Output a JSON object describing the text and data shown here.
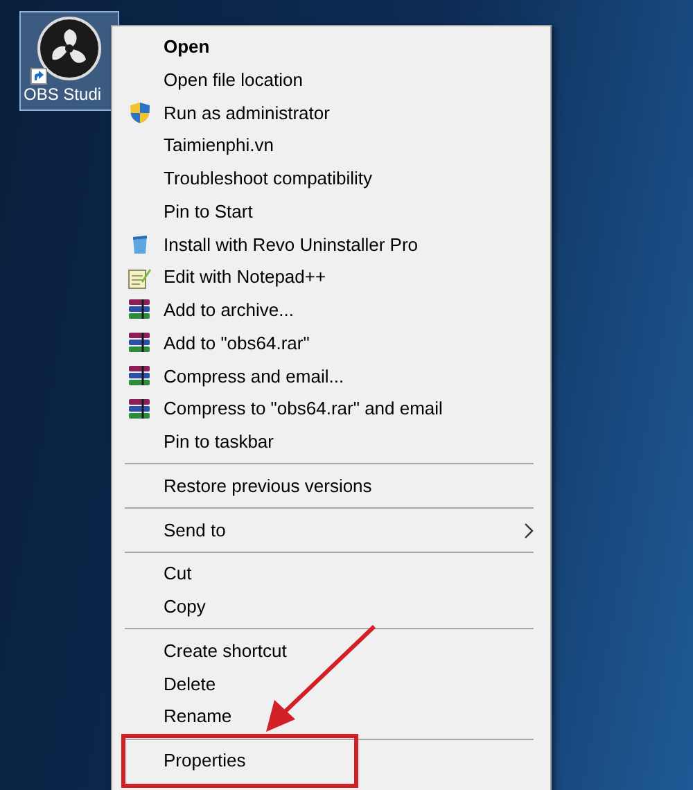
{
  "desktop_icon": {
    "label": "OBS Studi",
    "selected": true,
    "shortcut": true
  },
  "context_menu": {
    "items": [
      {
        "kind": "plain",
        "label": "Open",
        "default": true
      },
      {
        "kind": "plain",
        "label": "Open file location"
      },
      {
        "kind": "shield",
        "label": "Run as administrator"
      },
      {
        "kind": "plain",
        "label": "Taimienphi.vn"
      },
      {
        "kind": "plain",
        "label": "Troubleshoot compatibility"
      },
      {
        "kind": "plain",
        "label": "Pin to Start"
      },
      {
        "kind": "bin",
        "label": "Install with Revo Uninstaller Pro"
      },
      {
        "kind": "notepad",
        "label": "Edit with Notepad++"
      },
      {
        "kind": "archive",
        "label": "Add to archive..."
      },
      {
        "kind": "archive",
        "label": "Add to \"obs64.rar\""
      },
      {
        "kind": "archive",
        "label": "Compress and email..."
      },
      {
        "kind": "archive",
        "label": "Compress to \"obs64.rar\" and email"
      },
      {
        "kind": "plain",
        "label": "Pin to taskbar"
      },
      {
        "kind": "separator"
      },
      {
        "kind": "plain",
        "label": "Restore previous versions"
      },
      {
        "kind": "separator"
      },
      {
        "kind": "plain",
        "label": "Send to",
        "submenu": true
      },
      {
        "kind": "separator"
      },
      {
        "kind": "plain",
        "label": "Cut"
      },
      {
        "kind": "plain",
        "label": "Copy"
      },
      {
        "kind": "separator"
      },
      {
        "kind": "plain",
        "label": "Create shortcut"
      },
      {
        "kind": "plain",
        "label": "Delete"
      },
      {
        "kind": "plain",
        "label": "Rename"
      },
      {
        "kind": "separator"
      },
      {
        "kind": "plain",
        "label": "Properties"
      }
    ]
  },
  "annotation": {
    "arrow": true,
    "frame": true
  }
}
